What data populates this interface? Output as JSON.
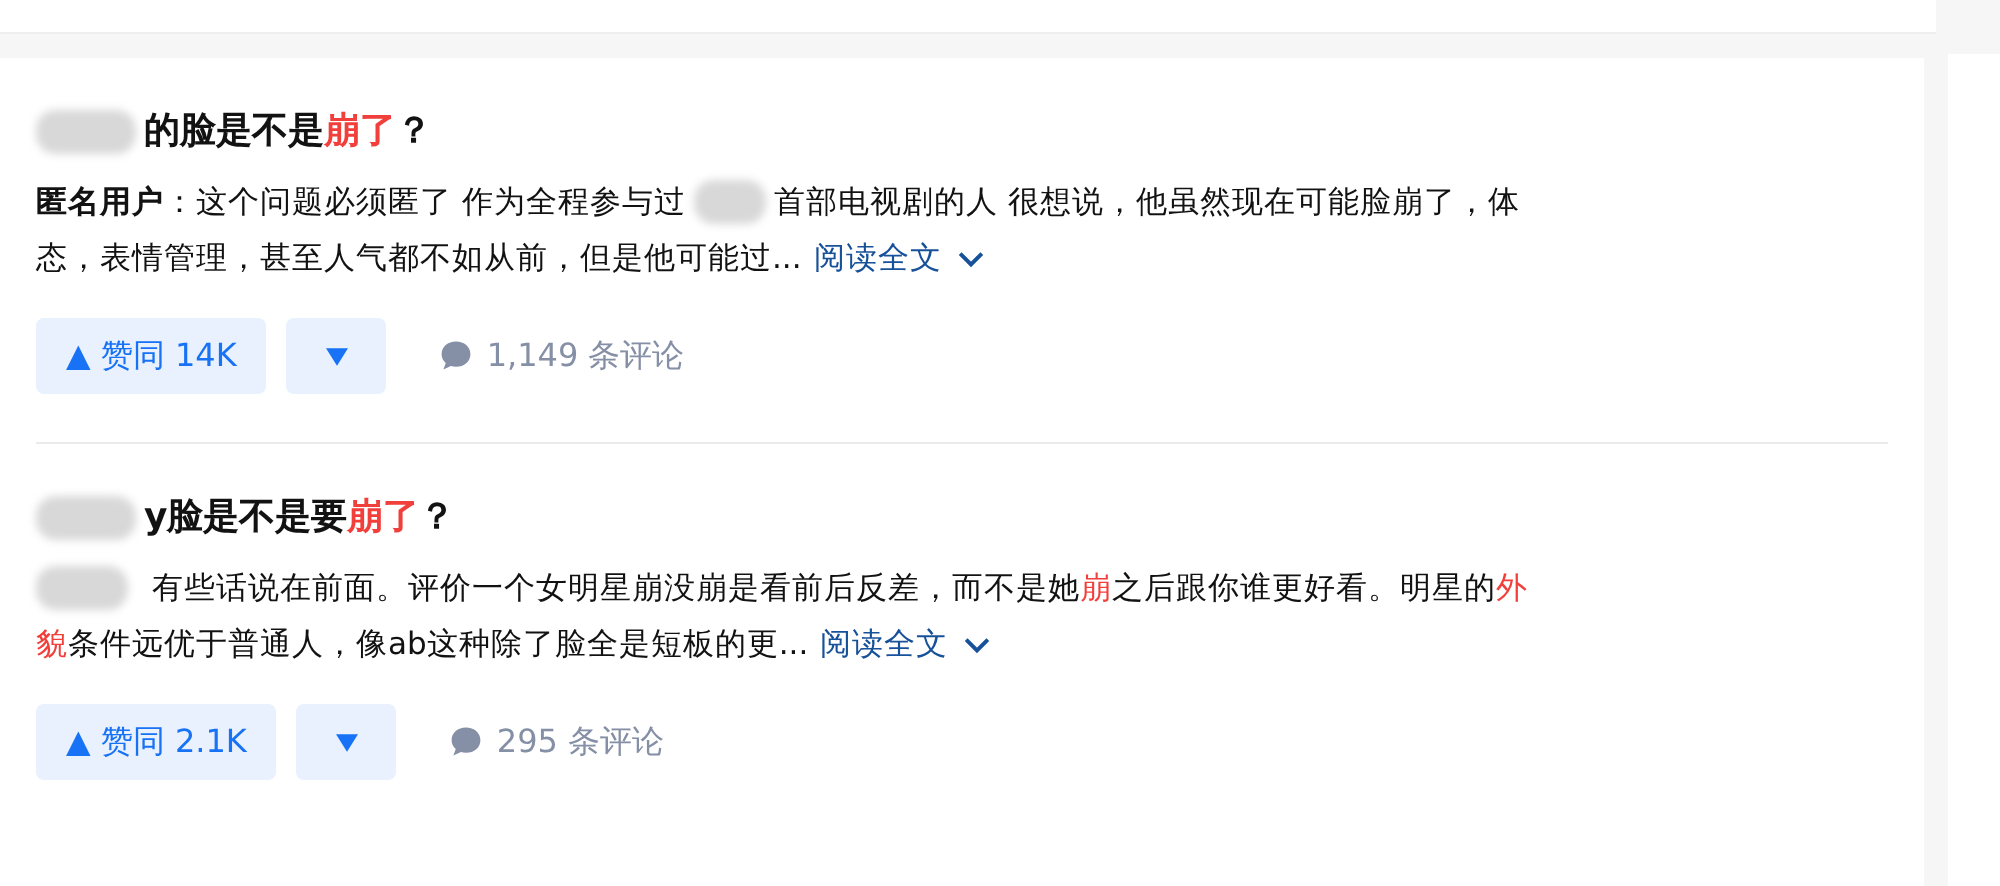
{
  "results": [
    {
      "title": [
        {
          "kind": "redacted"
        },
        {
          "kind": "text",
          "text": "的脸是不是",
          "highlight": false
        },
        {
          "kind": "text",
          "text": "崩了",
          "highlight": true
        },
        {
          "kind": "text",
          "text": "？",
          "highlight": false
        }
      ],
      "excerpt_lines": [
        [
          {
            "kind": "author",
            "text": "匿名用户"
          },
          {
            "kind": "text",
            "text": "：这个问题必须匿了 作为全程参与过",
            "highlight": false
          },
          {
            "kind": "redacted"
          },
          {
            "kind": "text",
            "text": "首部电视剧的人 很想说，他虽然现在可能脸崩了，体",
            "highlight": false
          }
        ],
        [
          {
            "kind": "text",
            "text": "态，表情管理，甚至人气都不如从前，但是他可能过...",
            "highlight": false
          }
        ]
      ],
      "read_more": "阅读全文",
      "upvote": "▲ 赞同 14K",
      "comments": "1,149 条评论"
    },
    {
      "title": [
        {
          "kind": "redacted"
        },
        {
          "kind": "text",
          "text": "y脸是不是要",
          "highlight": false
        },
        {
          "kind": "text",
          "text": "崩了",
          "highlight": true
        },
        {
          "kind": "text",
          "text": "？",
          "highlight": false
        }
      ],
      "excerpt_lines": [
        [
          {
            "kind": "redacted"
          },
          {
            "kind": "text",
            "text": "有些话说在前面。评价一个女明星崩没崩是看前后反差，而不是她",
            "highlight": false
          },
          {
            "kind": "text",
            "text": "崩",
            "highlight": true
          },
          {
            "kind": "text",
            "text": "之后跟你谁更好看。明星的",
            "highlight": false
          },
          {
            "kind": "text",
            "text": "外",
            "highlight": true
          }
        ],
        [
          {
            "kind": "text",
            "text": "貌",
            "highlight": true
          },
          {
            "kind": "text",
            "text": "条件远优于普通人，像ab这种除了脸全是短板的更...",
            "highlight": false
          }
        ]
      ],
      "read_more": "阅读全文",
      "upvote": "▲ 赞同 2.1K",
      "comments": "295 条评论"
    }
  ]
}
